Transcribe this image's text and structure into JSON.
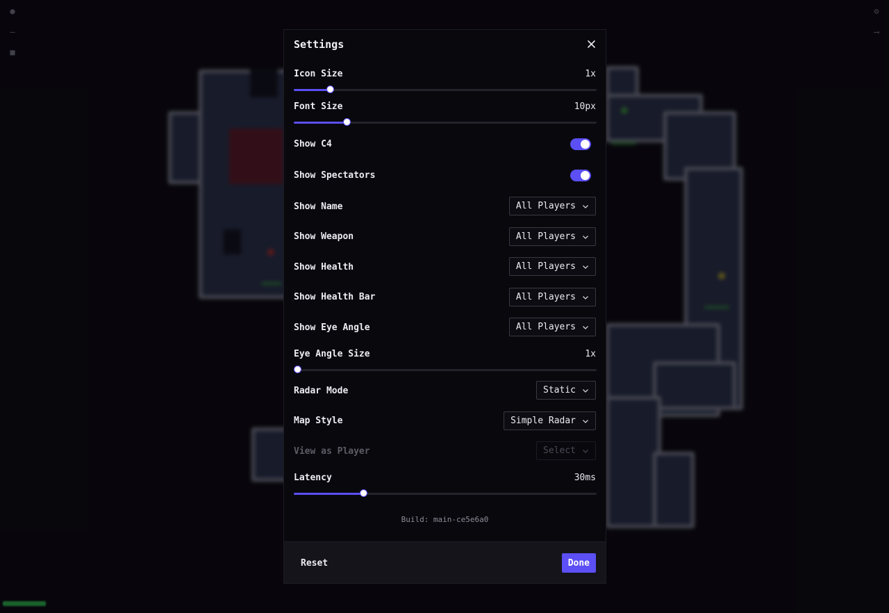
{
  "modal": {
    "title": "Settings",
    "close_icon": "close-icon"
  },
  "settings": {
    "icon_size": {
      "label": "Icon Size",
      "value_text": "1x",
      "fraction": 0.12
    },
    "font_size": {
      "label": "Font Size",
      "value_text": "10px",
      "fraction": 0.175
    },
    "show_c4": {
      "label": "Show C4",
      "on": true
    },
    "show_spectators": {
      "label": "Show Spectators",
      "on": true
    },
    "show_name": {
      "label": "Show Name",
      "selected": "All Players"
    },
    "show_weapon": {
      "label": "Show Weapon",
      "selected": "All Players"
    },
    "show_health": {
      "label": "Show Health",
      "selected": "All Players"
    },
    "show_health_bar": {
      "label": "Show Health Bar",
      "selected": "All Players"
    },
    "show_eye_angle": {
      "label": "Show Eye Angle",
      "selected": "All Players"
    },
    "eye_angle_size": {
      "label": "Eye Angle Size",
      "value_text": "1x",
      "fraction": 0.012
    },
    "radar_mode": {
      "label": "Radar Mode",
      "selected": "Static"
    },
    "map_style": {
      "label": "Map Style",
      "selected": "Simple Radar"
    },
    "view_as_player": {
      "label": "View as Player",
      "selected": "Select",
      "disabled": true
    },
    "latency": {
      "label": "Latency",
      "value_text": "30ms",
      "fraction": 0.23
    }
  },
  "build": "Build: main-ce5e6a0",
  "footer": {
    "reset_label": "Reset",
    "done_label": "Done"
  },
  "colors": {
    "accent": "#5b4ff5",
    "modal_bg": "#09080d",
    "footer_bg": "#15141b"
  }
}
